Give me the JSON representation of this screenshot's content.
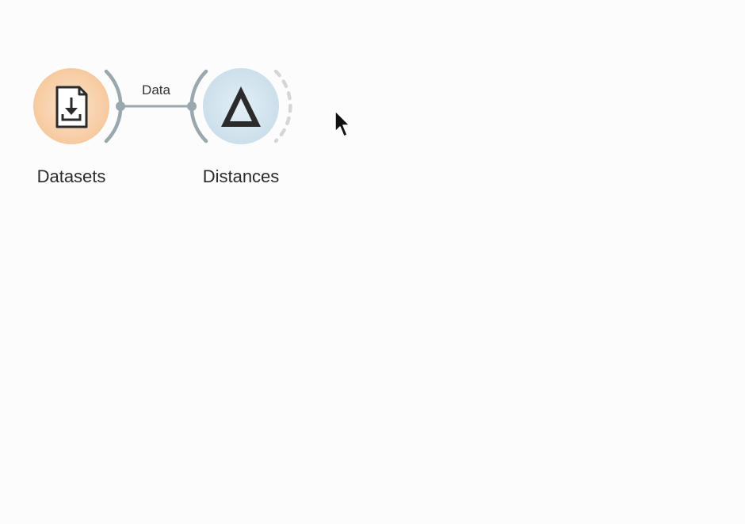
{
  "canvas": {
    "background": "#fcfcfc"
  },
  "nodes": [
    {
      "label": "Datasets",
      "icon": "file-download-icon",
      "fill_color": "#f6c79a",
      "outline_color": "#f3d9bf"
    },
    {
      "label": "Distances",
      "icon": "delta-icon",
      "fill_color": "#cfe1ec",
      "outline_color": "#e2edf4"
    }
  ],
  "links": [
    {
      "label": "Data",
      "color": "#9aa8ae"
    }
  ],
  "cursor": {
    "icon": "mouse-pointer-icon"
  }
}
